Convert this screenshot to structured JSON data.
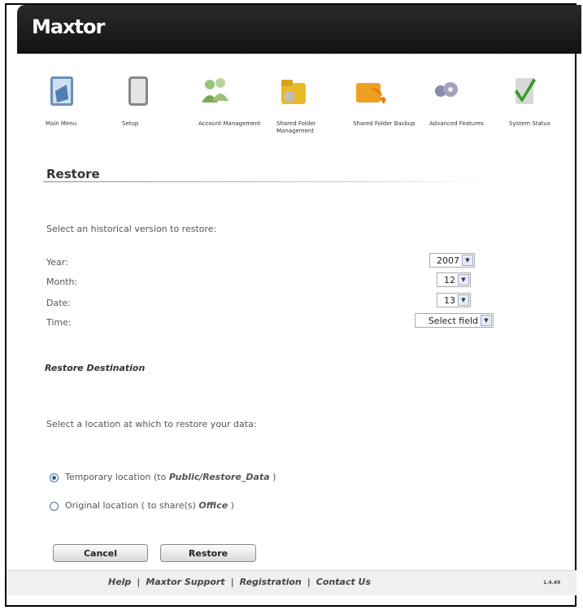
{
  "brand": {
    "logo": "Maxtor"
  },
  "nav": [
    {
      "label": "Main Menu",
      "icon": "main-menu-icon"
    },
    {
      "label": "Setup",
      "icon": "setup-icon"
    },
    {
      "label": "Account Management",
      "icon": "account-management-icon"
    },
    {
      "label": "Shared Folder Management",
      "icon": "shared-folder-management-icon"
    },
    {
      "label": "Shared Folder Backup",
      "icon": "shared-folder-backup-icon"
    },
    {
      "label": "Advanced Features",
      "icon": "advanced-features-icon"
    },
    {
      "label": "System Status",
      "icon": "system-status-icon"
    }
  ],
  "page": {
    "title": "Restore",
    "instruction": "Select an historical version to restore:"
  },
  "fields": {
    "year": {
      "label": "Year:",
      "value": "2007"
    },
    "month": {
      "label": "Month:",
      "value": "12"
    },
    "date": {
      "label": "Date:",
      "value": "13"
    },
    "time": {
      "label": "Time:",
      "value": "Select field"
    }
  },
  "destination": {
    "heading": "Restore Destination",
    "instruction": "Select a location at which to restore your data:",
    "options": [
      {
        "prefix": "Temporary location (to ",
        "path": "Public/Restore_Data",
        "suffix": " )",
        "checked": true
      },
      {
        "prefix": "Original location ( to share(s) ",
        "path": "Office",
        "suffix": " )",
        "checked": false
      }
    ]
  },
  "buttons": {
    "cancel": "Cancel",
    "restore": "Restore"
  },
  "footer": {
    "links": [
      "Help",
      "Maxtor Support",
      "Registration",
      "Contact Us"
    ],
    "separator": "|",
    "version": "1.4.49"
  },
  "colors": {
    "header": "#1b1b1b",
    "radio": "#3c5f99",
    "accent_green": "#3a9a2a"
  }
}
